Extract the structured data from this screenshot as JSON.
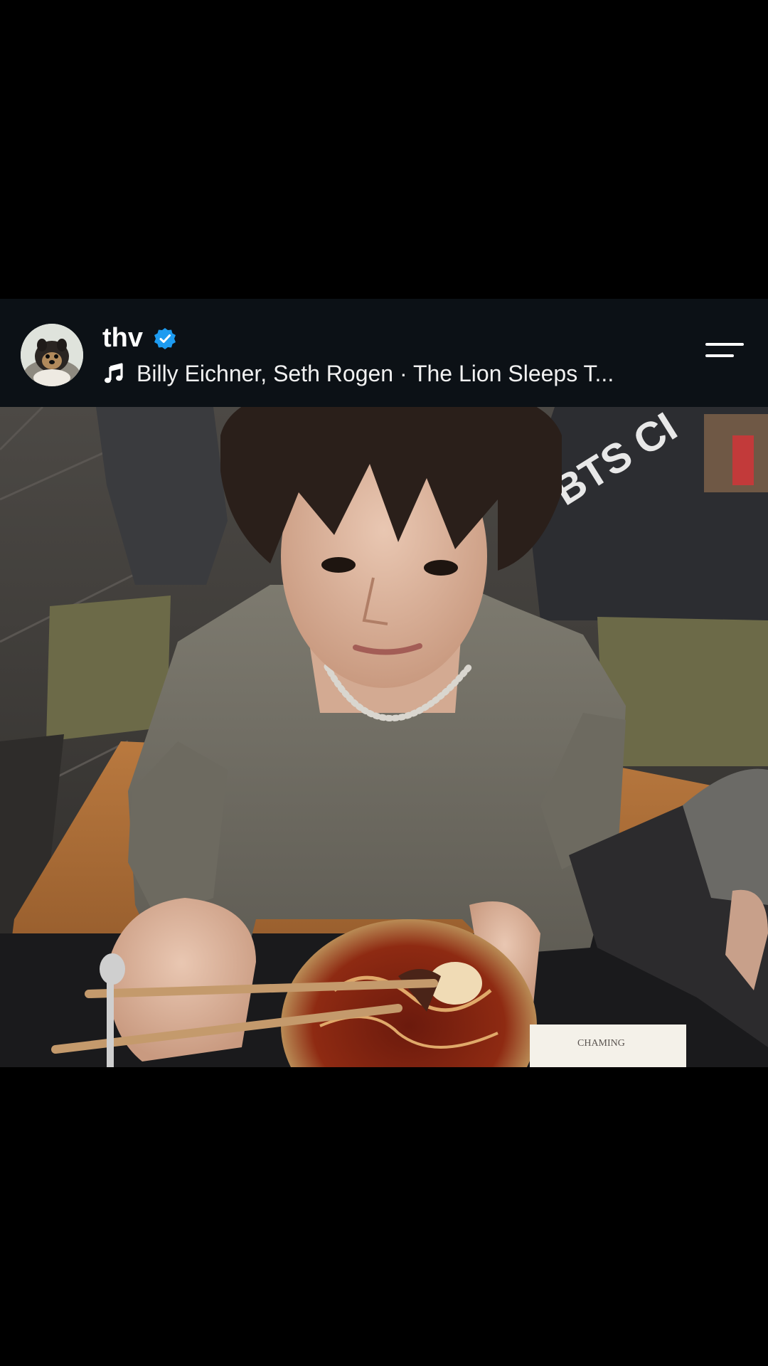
{
  "post": {
    "username": "thv",
    "verified": true,
    "audio": {
      "artists": "Billy Eichner, Seth Rogen",
      "separator": "·",
      "track": "The Lion Sleeps T...",
      "display": "Billy Eichner, Seth Rogen · The Lion Sleeps T..."
    }
  },
  "photo": {
    "shirt_text": "BTS CI"
  },
  "icons": {
    "verified": "verified-badge-icon",
    "music": "music-note-icon",
    "menu": "menu-icon",
    "avatar": "avatar"
  },
  "colors": {
    "header_bg": "#0c1116",
    "verified_blue": "#1d9bf0",
    "page_bg": "#000000"
  }
}
